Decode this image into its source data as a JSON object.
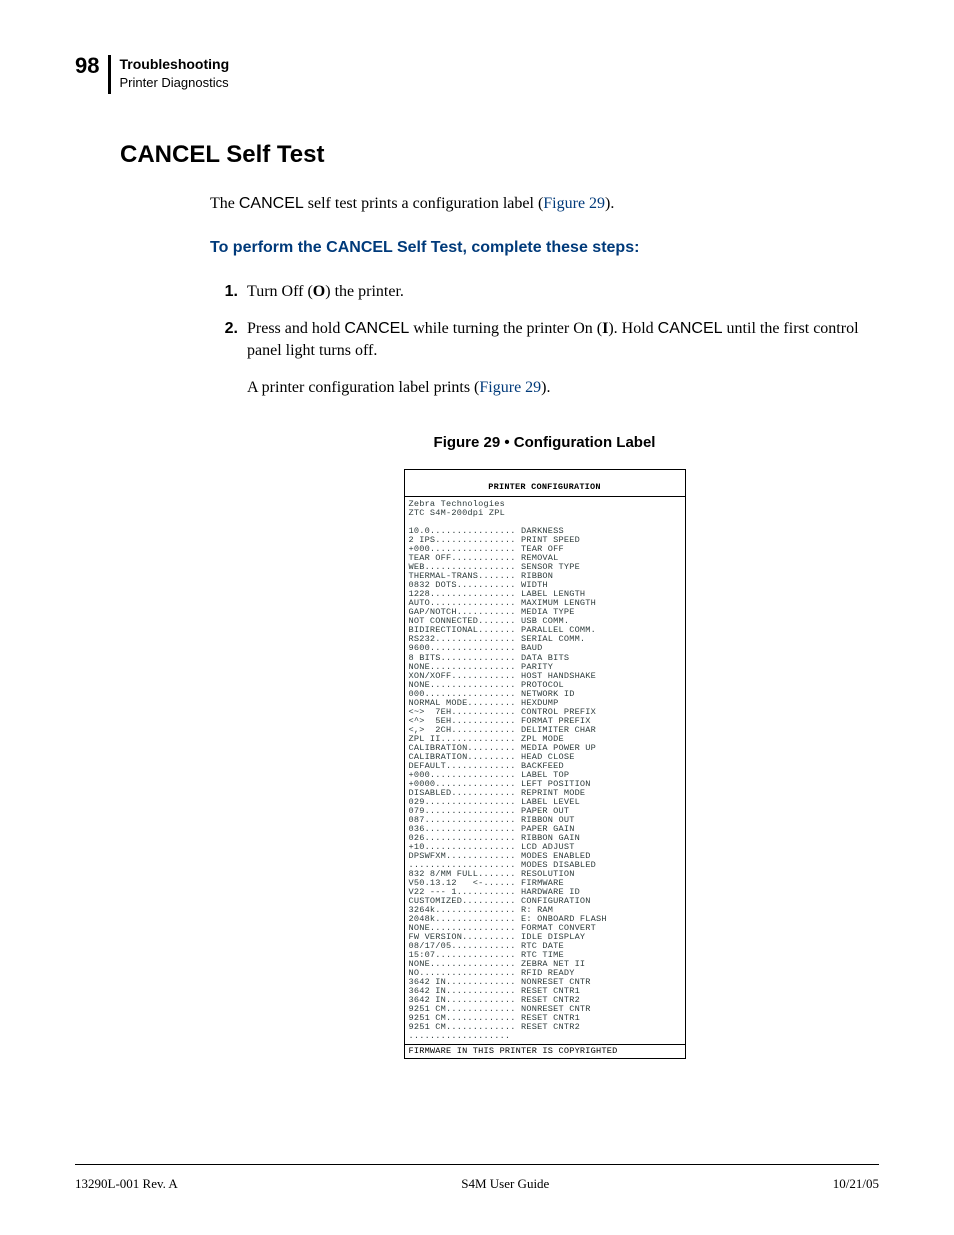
{
  "header": {
    "page_number": "98",
    "chapter": "Troubleshooting",
    "section": "Printer Diagnostics"
  },
  "section_title": "CANCEL Self Test",
  "intro": {
    "pre": "The ",
    "cancel1": "CANCEL",
    "mid": " self test prints a configuration label (",
    "figref": "Figure 29",
    "post": ")."
  },
  "steps_heading": "To perform the CANCEL Self Test, complete these steps:",
  "steps": [
    {
      "label": "1.",
      "text_pre": "Turn Off (",
      "bold1": "O",
      "text_post": ") the printer."
    },
    {
      "label": "2.",
      "text_pre": "Press and hold ",
      "cancel": "CANCEL",
      "mid1": " while turning the printer On (",
      "bold1": "I",
      "mid2": "). Hold ",
      "cancel2": "CANCEL",
      "post": " until the first control panel light turns off."
    }
  ],
  "after_steps": {
    "pre": "A printer configuration label prints (",
    "figref": "Figure 29",
    "post": ")."
  },
  "figure_caption": "Figure 29 • Configuration Label",
  "config_label": {
    "title": "PRINTER CONFIGURATION",
    "vendor": "Zebra Technologies",
    "model": "ZTC S4M-200dpi ZPL",
    "rows": [
      [
        "10.0",
        "DARKNESS"
      ],
      [
        "2 IPS",
        "PRINT SPEED"
      ],
      [
        "+000",
        "TEAR OFF"
      ],
      [
        "TEAR OFF",
        "REMOVAL"
      ],
      [
        "WEB",
        "SENSOR TYPE"
      ],
      [
        "THERMAL-TRANS",
        "RIBBON"
      ],
      [
        "0832 DOTS",
        "WIDTH"
      ],
      [
        "1228",
        "LABEL LENGTH"
      ],
      [
        "AUTO",
        "MAXIMUM LENGTH"
      ],
      [
        "GAP/NOTCH",
        "MEDIA TYPE"
      ],
      [
        "NOT CONNECTED",
        "USB COMM."
      ],
      [
        "BIDIRECTIONAL",
        "PARALLEL COMM."
      ],
      [
        "RS232",
        "SERIAL COMM."
      ],
      [
        "9600",
        "BAUD"
      ],
      [
        "8 BITS",
        "DATA BITS"
      ],
      [
        "NONE",
        "PARITY"
      ],
      [
        "XON/XOFF",
        "HOST HANDSHAKE"
      ],
      [
        "NONE",
        "PROTOCOL"
      ],
      [
        "000",
        "NETWORK ID"
      ],
      [
        "NORMAL MODE",
        "HEXDUMP"
      ],
      [
        "<~>  7EH",
        "CONTROL PREFIX"
      ],
      [
        "<^>  5EH",
        "FORMAT PREFIX"
      ],
      [
        "<,>  2CH",
        "DELIMITER CHAR"
      ],
      [
        "ZPL II",
        "ZPL MODE"
      ],
      [
        "CALIBRATION",
        "MEDIA POWER UP"
      ],
      [
        "CALIBRATION",
        "HEAD CLOSE"
      ],
      [
        "DEFAULT",
        "BACKFEED"
      ],
      [
        "+000",
        "LABEL TOP"
      ],
      [
        "+0000",
        "LEFT POSITION"
      ],
      [
        "DISABLED",
        "REPRINT MODE"
      ],
      [
        "029",
        "LABEL LEVEL"
      ],
      [
        "079",
        "PAPER OUT"
      ],
      [
        "087",
        "RIBBON OUT"
      ],
      [
        "036",
        "PAPER GAIN"
      ],
      [
        "026",
        "RIBBON GAIN"
      ],
      [
        "+10",
        "LCD ADJUST"
      ],
      [
        "DPSWFXM",
        "MODES ENABLED"
      ],
      [
        "",
        "MODES DISABLED"
      ],
      [
        "832 8/MM FULL",
        "RESOLUTION"
      ],
      [
        "V50.13.12   <-",
        "FIRMWARE"
      ],
      [
        "V22 --- 1",
        "HARDWARE ID"
      ],
      [
        "CUSTOMIZED",
        "CONFIGURATION"
      ],
      [
        "3264k",
        "R: RAM"
      ],
      [
        "2048k",
        "E: ONBOARD FLASH"
      ],
      [
        "NONE",
        "FORMAT CONVERT"
      ],
      [
        "FW VERSION",
        "IDLE DISPLAY"
      ],
      [
        "08/17/05",
        "RTC DATE"
      ],
      [
        "15:07",
        "RTC TIME"
      ],
      [
        "NONE",
        "ZEBRA NET II"
      ],
      [
        "NO",
        "RFID READY"
      ],
      [
        "3642 IN",
        "NONRESET CNTR"
      ],
      [
        "3642 IN",
        "RESET CNTR1"
      ],
      [
        "3642 IN",
        "RESET CNTR2"
      ],
      [
        "9251 CM",
        "NONRESET CNTR"
      ],
      [
        "9251 CM",
        "RESET CNTR1"
      ],
      [
        "9251 CM",
        "RESET CNTR2"
      ]
    ],
    "trailer_dots": "...................",
    "footer": "FIRMWARE IN THIS PRINTER IS COPYRIGHTED"
  },
  "footer": {
    "left": "13290L-001 Rev. A",
    "center": "S4M User Guide",
    "right": "10/21/05"
  }
}
